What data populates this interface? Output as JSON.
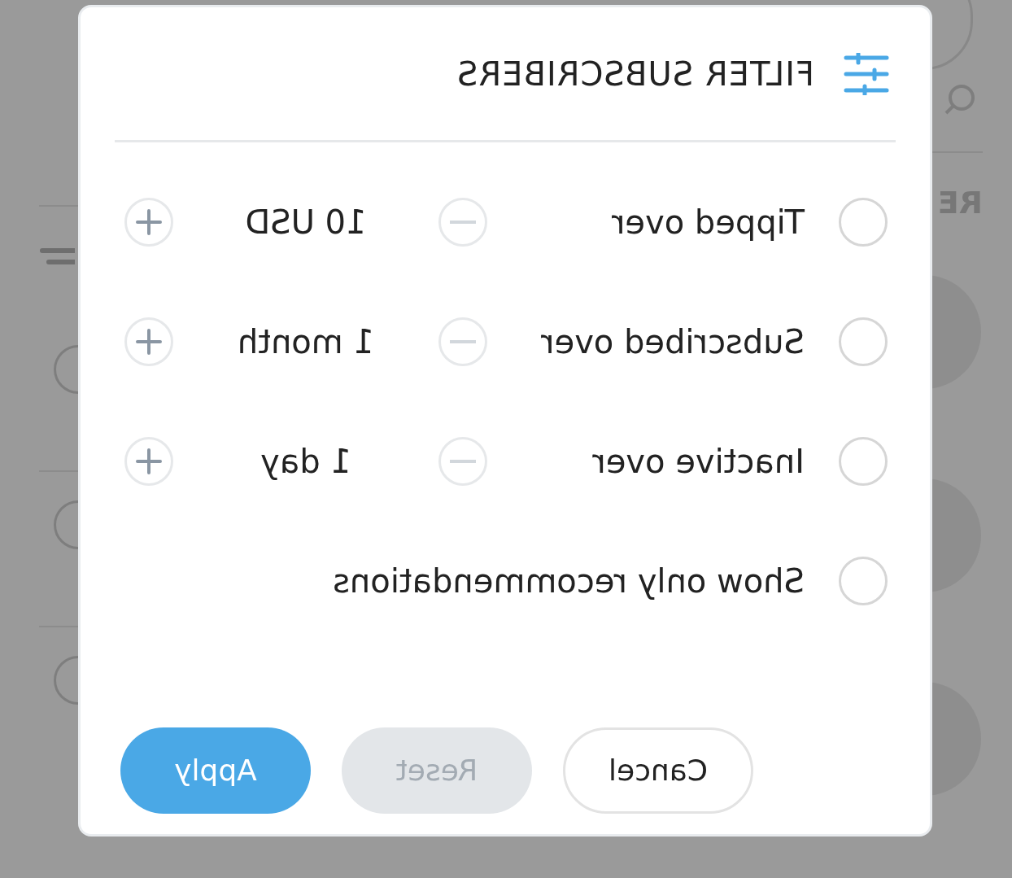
{
  "dialog": {
    "title": "FILTER SUBSCRIBERS",
    "options": [
      {
        "kind": "stepper",
        "label": "Tipped over",
        "selected": false,
        "value": "10 USD"
      },
      {
        "kind": "stepper",
        "label": "Subscribed over",
        "selected": false,
        "value": "1 month"
      },
      {
        "kind": "stepper",
        "label": "Inactive over",
        "selected": false,
        "value": "1 day"
      },
      {
        "kind": "toggle",
        "label": "Show only recommendations",
        "selected": false
      }
    ],
    "buttons": [
      {
        "kind": "primary",
        "label": "Apply"
      },
      {
        "kind": "secondary",
        "label": "Reset",
        "disabled": true
      },
      {
        "kind": "outline",
        "label": "Cancel"
      }
    ]
  },
  "background": {
    "section_label": "RE"
  }
}
